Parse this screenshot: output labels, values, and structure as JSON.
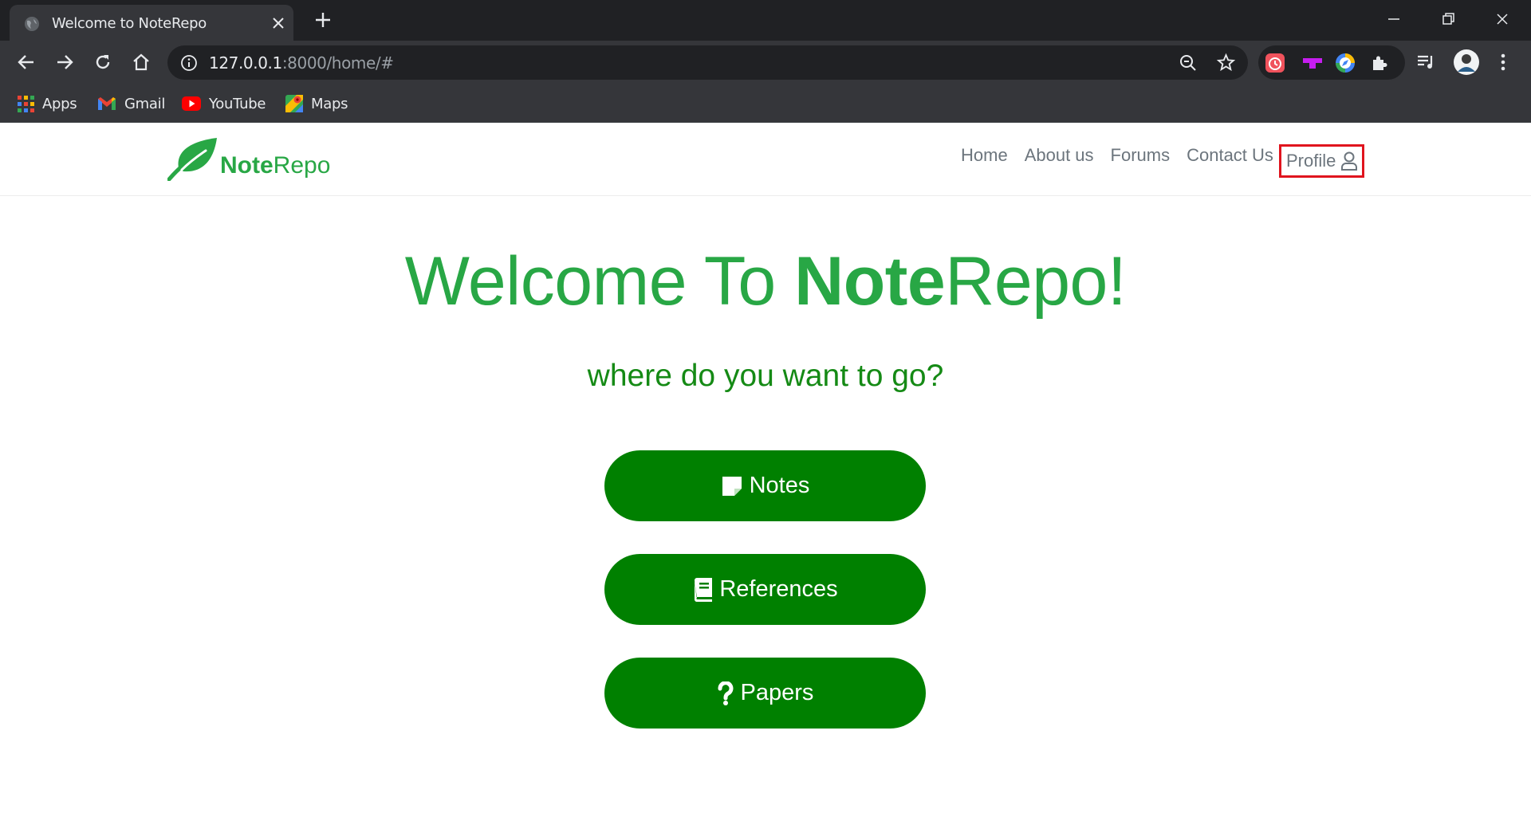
{
  "browser": {
    "tab_title": "Welcome to NoteRepo",
    "url_host": "127.0.0.1",
    "url_path": ":8000/home/#",
    "bookmarks": [
      {
        "label": "Apps",
        "icon": "apps-grid-icon"
      },
      {
        "label": "Gmail",
        "icon": "gmail-icon"
      },
      {
        "label": "YouTube",
        "icon": "youtube-icon"
      },
      {
        "label": "Maps",
        "icon": "maps-icon"
      }
    ]
  },
  "site": {
    "brand_bold": "Note",
    "brand_rest": "Repo",
    "nav": {
      "home": "Home",
      "about": "About us",
      "forums": "Forums",
      "contact": "Contact Us",
      "profile": "Profile"
    },
    "hero": {
      "title_prefix": "Welcome To ",
      "title_bold": "Note",
      "title_suffix": "Repo!",
      "subtitle": "where do you want to go?"
    },
    "buttons": {
      "notes": "Notes",
      "references": "References",
      "papers": "Papers"
    }
  },
  "colors": {
    "brand_green": "#28a745",
    "button_green": "#008000",
    "highlight_red": "#e0141e"
  }
}
